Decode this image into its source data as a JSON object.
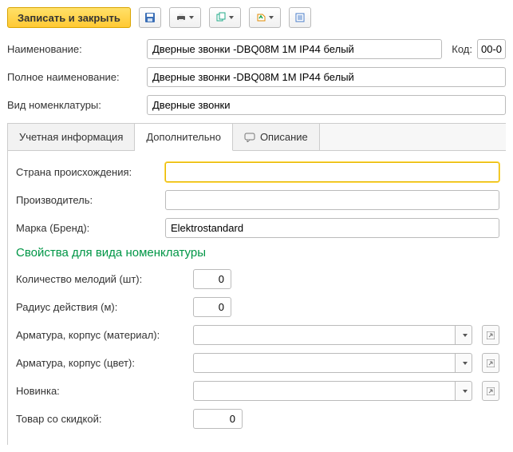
{
  "toolbar": {
    "save_close": "Записать и закрыть"
  },
  "fields": {
    "name_label": "Наименование:",
    "name_value": "Дверные звонки -DBQ08M 1M IP44 белый",
    "code_label": "Код:",
    "code_value": "00-0",
    "fullname_label": "Полное наименование:",
    "fullname_value": "Дверные звонки -DBQ08M 1M IP44 белый",
    "kind_label": "Вид номенклатуры:",
    "kind_value": "Дверные звонки"
  },
  "tabs": {
    "t1": "Учетная информация",
    "t2": "Дополнительно",
    "t3": "Описание"
  },
  "extra": {
    "country_label": "Страна происхождения:",
    "country_value": "",
    "manufacturer_label": "Производитель:",
    "manufacturer_value": "",
    "brand_label": "Марка (Бренд):",
    "brand_value": "Elektrostandard"
  },
  "props": {
    "section_title": "Свойства для вида номенклатуры",
    "melodies_label": "Количество мелодий (шт):",
    "melodies_value": "0",
    "radius_label": "Радиус действия (м):",
    "radius_value": "0",
    "material_label": "Арматура, корпус (материал):",
    "material_value": "",
    "color_label": "Арматура, корпус (цвет):",
    "color_value": "",
    "novelty_label": "Новинка:",
    "novelty_value": "",
    "discount_label": "Товар со скидкой:",
    "discount_value": "0"
  }
}
